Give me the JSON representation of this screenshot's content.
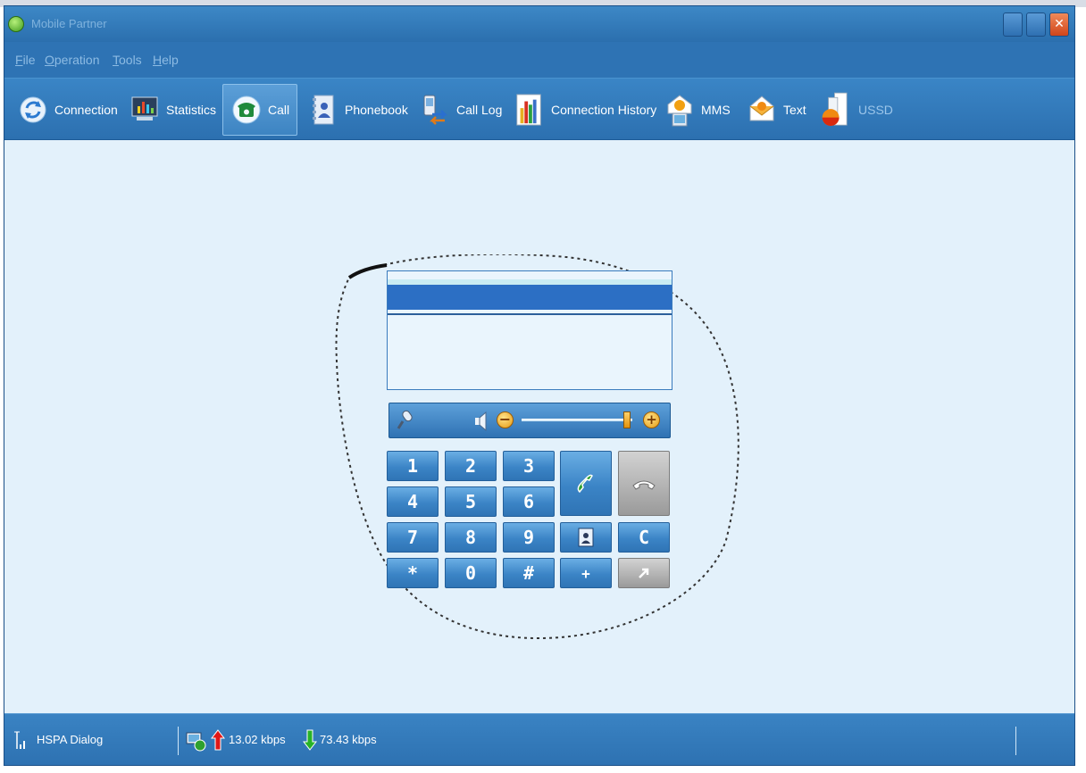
{
  "window": {
    "title": "Mobile Partner"
  },
  "menu": [
    {
      "label": "File",
      "accel": "F",
      "rest": "ile"
    },
    {
      "label": "Operation",
      "accel": "O",
      "rest": "peration"
    },
    {
      "label": "Tools",
      "accel": "T",
      "rest": "ools"
    },
    {
      "label": "Help",
      "accel": "H",
      "rest": "elp"
    }
  ],
  "toolbar": {
    "connection": "Connection",
    "statistics": "Statistics",
    "call": "Call",
    "phonebook": "Phonebook",
    "call_log": "Call Log",
    "connection_history": "Connection History",
    "mms": "MMS",
    "text": "Text",
    "ussd": "USSD",
    "active": "Call"
  },
  "call_panel": {
    "number": "",
    "volume_level": 0.95
  },
  "keypad": {
    "k1": "1",
    "k2": "2",
    "k3": "3",
    "k4": "4",
    "k5": "5",
    "k6": "6",
    "k7": "7",
    "k8": "8",
    "k9": "9",
    "kstar": "*",
    "k0": "0",
    "khash": "#",
    "kplus": "+",
    "kclear": "C"
  },
  "status": {
    "network": "HSPA Dialog",
    "upload": "13.02 kbps",
    "download": "73.43 kbps"
  },
  "colors": {
    "accent": "#2e73b4",
    "content_bg": "#e3f1fb",
    "call_green": "#2ea12e",
    "upload_red": "#e01818",
    "download_green": "#27b327"
  }
}
